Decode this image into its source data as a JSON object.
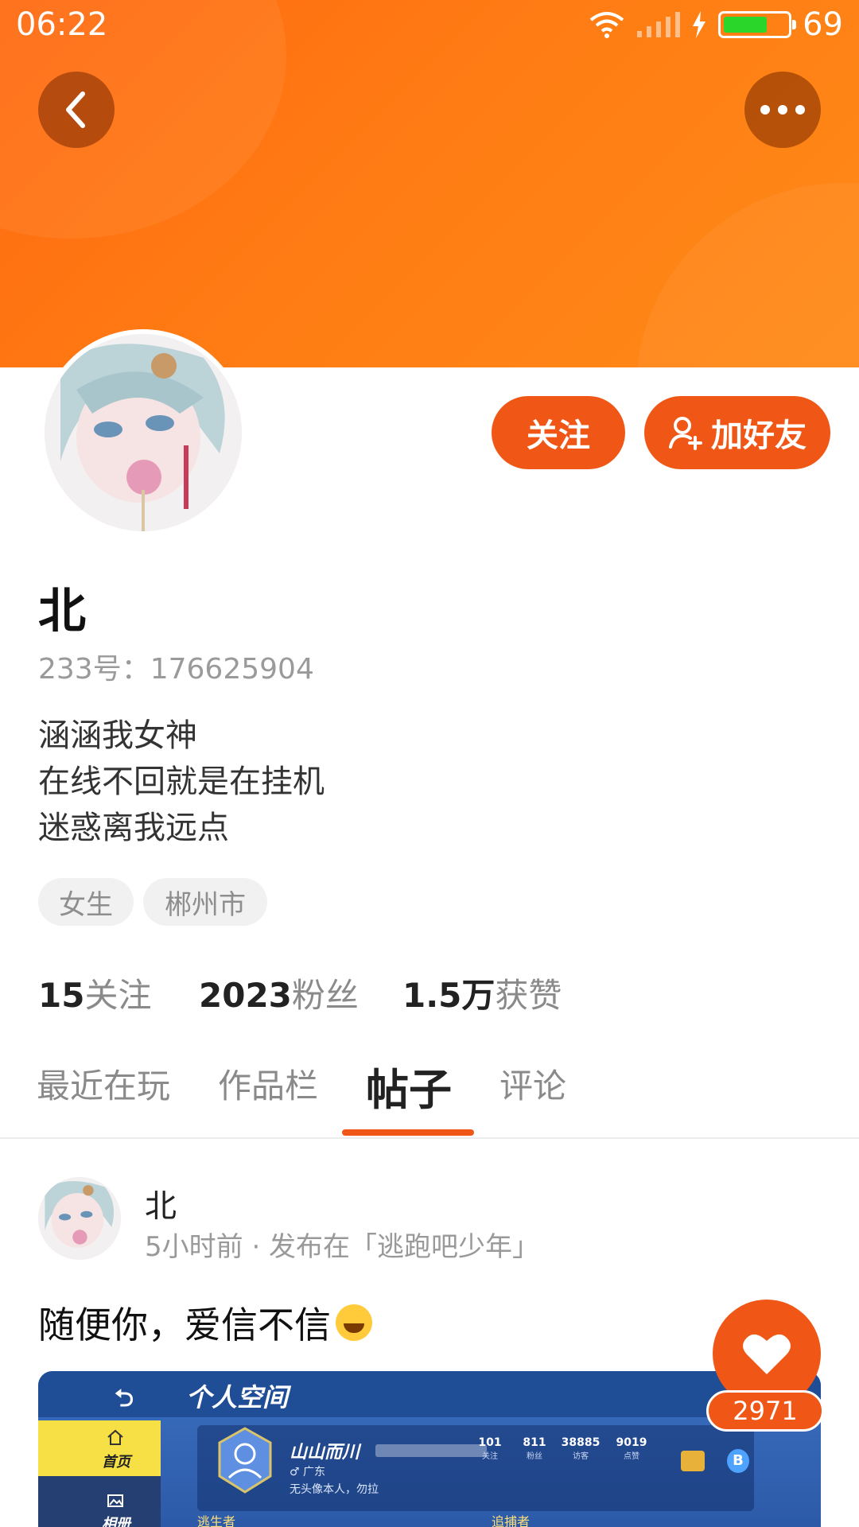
{
  "status_bar": {
    "time": "06:22",
    "battery": "69",
    "battery_level": 0.69
  },
  "profile": {
    "name": "北",
    "uid": "233号：176625904",
    "bio": [
      "涵涵我女神",
      "在线不回就是在挂机",
      "迷惑离我远点"
    ],
    "tags": [
      "女生",
      "郴州市"
    ],
    "follow_label": "关注",
    "add_friend_label": "加好友"
  },
  "stats": [
    {
      "num": "15",
      "label": "关注"
    },
    {
      "num": "2023",
      "label": "粉丝"
    },
    {
      "num": "1.5万",
      "label": "获赞"
    }
  ],
  "tabs": [
    {
      "label": "最近在玩",
      "active": false
    },
    {
      "label": "作品栏",
      "active": false
    },
    {
      "label": "帖子",
      "active": true
    },
    {
      "label": "评论",
      "active": false
    }
  ],
  "post": {
    "author": "北",
    "meta": "5小时前 · 发布在「逃跑吧少年」",
    "text": "随便你，爱信不信",
    "like_count": "2971",
    "image": {
      "title": "个人空间",
      "home_label": "首页",
      "album_label": "相册",
      "player_name": "山山而川",
      "region": "♂ 广东",
      "signature": "无头像本人，勿拉",
      "stats": [
        {
          "num": "101",
          "label": "关注"
        },
        {
          "num": "811",
          "label": "粉丝"
        },
        {
          "num": "38885",
          "label": "访客"
        },
        {
          "num": "9019",
          "label": "点赞"
        }
      ],
      "escaper_label": "逃生者",
      "chaser_label": "追捕者"
    }
  },
  "colors": {
    "accent": "#f05616",
    "header": "#ff7510"
  }
}
